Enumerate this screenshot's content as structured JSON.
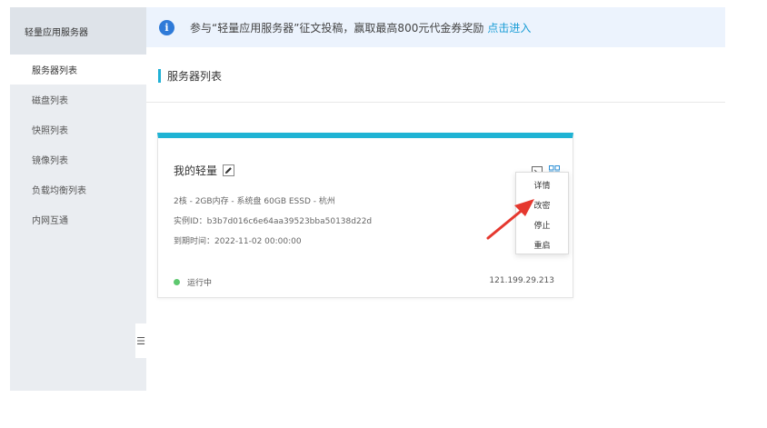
{
  "sidebar": {
    "title": "轻量应用服务器",
    "items": [
      {
        "label": "服务器列表",
        "active": true
      },
      {
        "label": "磁盘列表"
      },
      {
        "label": "快照列表"
      },
      {
        "label": "镜像列表"
      },
      {
        "label": "负载均衡列表"
      },
      {
        "label": "内网互通"
      }
    ],
    "collapse_icon": "menu-collapse-icon"
  },
  "banner": {
    "icon": "info-icon",
    "icon_glyph": "i",
    "text": "参与“轻量应用服务器”征文投稿，赢取最高800元代金券奖励",
    "link": "点击进入",
    "link_color": "#1a9dd6"
  },
  "section": {
    "title": "服务器列表"
  },
  "card": {
    "name": "我的轻量",
    "spec": "2核 - 2GB内存 - 系统盘 60GB ESSD - 杭州",
    "instance_id": "实例ID：b3b7d016c6e64aa39523bba50138d22d",
    "expire": "到期时间：2022-11-02 00:00:00",
    "status": "运行中",
    "status_color": "#5dc86f",
    "ip": "121.199.29.213",
    "accent_color": "#1fb3d4"
  },
  "menu": {
    "items": [
      "详情",
      "改密",
      "停止",
      "重启"
    ]
  },
  "annotation": {
    "arrow_color": "#e5382f"
  }
}
